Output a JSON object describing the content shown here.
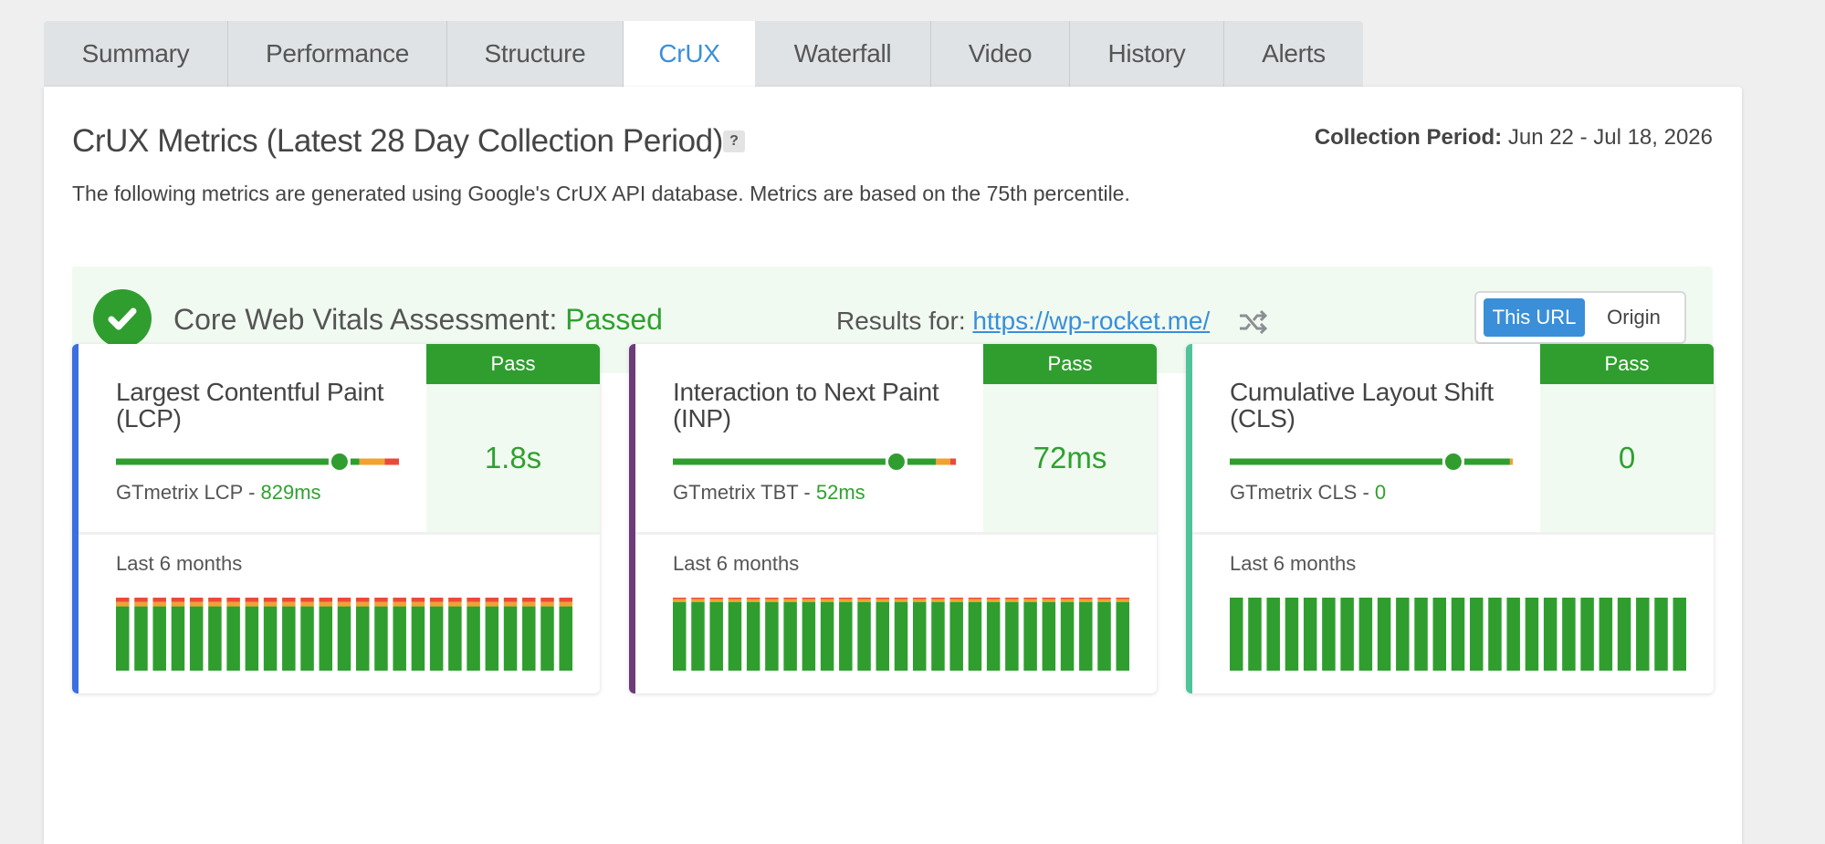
{
  "tabs": [
    {
      "label": "Summary",
      "active": false
    },
    {
      "label": "Performance",
      "active": false
    },
    {
      "label": "Structure",
      "active": false
    },
    {
      "label": "CrUX",
      "active": true
    },
    {
      "label": "Waterfall",
      "active": false
    },
    {
      "label": "Video",
      "active": false
    },
    {
      "label": "History",
      "active": false
    },
    {
      "label": "Alerts",
      "active": false
    }
  ],
  "header": {
    "title": "CrUX Metrics (Latest 28 Day Collection Period)",
    "help": "?",
    "collection_label": "Collection Period:",
    "collection_value": "Jun 22 - Jul 18, 2026",
    "description": "The following metrics are generated using Google's CrUX API database. Metrics are based on the 75th percentile."
  },
  "assessment": {
    "label": "Core Web Vitals Assessment",
    "colon": ":",
    "status": "Passed",
    "results_for": "Results for:",
    "url": "https://wp-rocket.me/",
    "toggle_on": "This URL",
    "toggle_off": "Origin"
  },
  "colors": {
    "pass_green": "#2f9e2f",
    "link_blue": "#3a8fd8",
    "warn_orange": "#f0a330",
    "fail_red": "#ea4a3c"
  },
  "cards": [
    {
      "name": "Largest Contentful Paint (LCP)",
      "status": "Pass",
      "value": "1.8s",
      "gt_label": "GTmetrix LCP - ",
      "gt_value": "829ms",
      "months_label": "Last 6 months",
      "accent": "#3b6fe0",
      "marker": 0.79,
      "good_share": 0.86,
      "ni_share": 0.09,
      "poor_share": 0.05,
      "hist": {
        "bars": 25,
        "good": 0.88,
        "ni": 0.06,
        "poor": 0.06
      }
    },
    {
      "name": "Interaction to Next Paint (INP)",
      "status": "Pass",
      "value": "72ms",
      "gt_label": "GTmetrix TBT - ",
      "gt_value": "52ms",
      "months_label": "Last 6 months",
      "accent": "#6b3b7a",
      "marker": 0.79,
      "good_share": 0.93,
      "ni_share": 0.05,
      "poor_share": 0.02,
      "hist": {
        "bars": 25,
        "good": 0.94,
        "ni": 0.04,
        "poor": 0.02
      }
    },
    {
      "name": "Cumulative Layout Shift (CLS)",
      "status": "Pass",
      "value": "0",
      "gt_label": "GTmetrix CLS - ",
      "gt_value": "0",
      "months_label": "Last 6 months",
      "accent": "#4fc39a",
      "marker": 0.79,
      "good_share": 0.99,
      "ni_share": 0.01,
      "poor_share": 0.0,
      "hist": {
        "bars": 25,
        "good": 1.0,
        "ni": 0.0,
        "poor": 0.0
      }
    }
  ]
}
